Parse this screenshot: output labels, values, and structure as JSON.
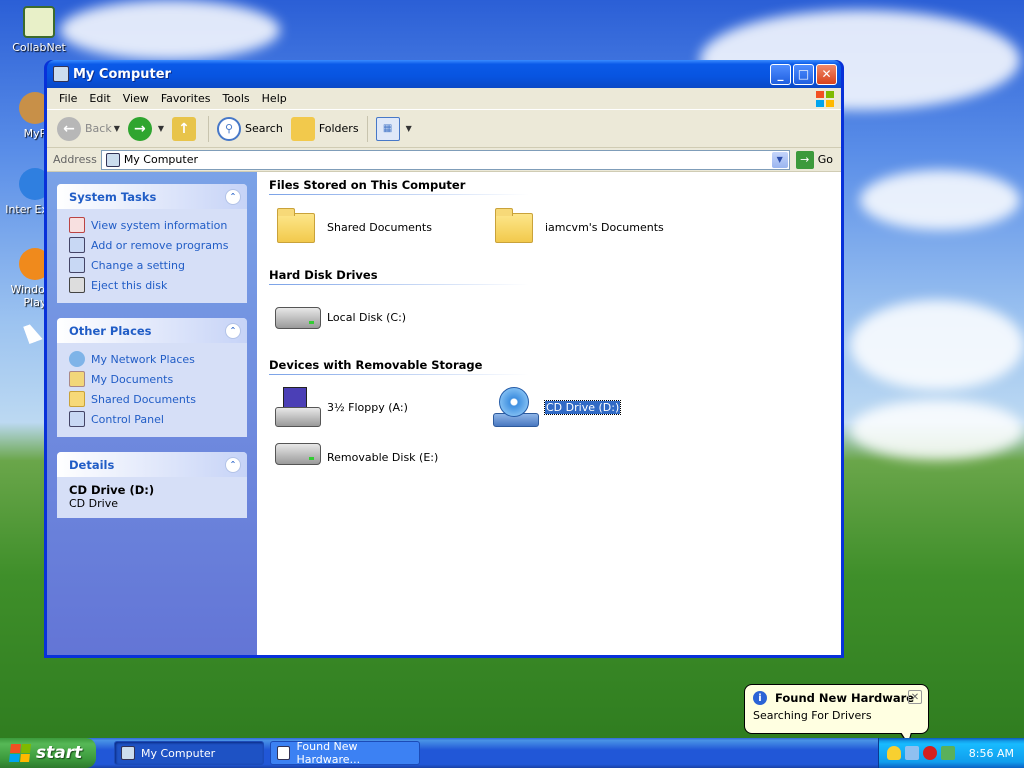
{
  "desktop": {
    "icons": [
      {
        "label": "CollabNet"
      },
      {
        "label": "MyP"
      },
      {
        "label": "Inter Explo"
      },
      {
        "label": "Windows Play"
      }
    ]
  },
  "window": {
    "title": "My Computer",
    "menu": [
      "File",
      "Edit",
      "View",
      "Favorites",
      "Tools",
      "Help"
    ],
    "toolbar": {
      "back": "Back",
      "search": "Search",
      "folders": "Folders"
    },
    "address": {
      "label": "Address",
      "value": "My Computer",
      "go": "Go"
    },
    "left_pane": {
      "system_tasks": {
        "title": "System Tasks",
        "items": [
          "View system information",
          "Add or remove programs",
          "Change a setting",
          "Eject this disk"
        ]
      },
      "other_places": {
        "title": "Other Places",
        "items": [
          "My Network Places",
          "My Documents",
          "Shared Documents",
          "Control Panel"
        ]
      },
      "details": {
        "title": "Details",
        "name": "CD Drive (D:)",
        "type": "CD Drive"
      }
    },
    "groups": {
      "files": {
        "title": "Files Stored on This Computer",
        "items": [
          "Shared Documents",
          "iamcvm's Documents"
        ]
      },
      "hard_disks": {
        "title": "Hard Disk Drives",
        "items": [
          "Local Disk (C:)"
        ]
      },
      "removable": {
        "title": "Devices with Removable Storage",
        "items": [
          "3½ Floppy (A:)",
          "CD Drive (D:)",
          "Removable Disk (E:)"
        ]
      }
    }
  },
  "taskbar": {
    "start": "start",
    "tasks": [
      "My Computer",
      "Found New Hardware..."
    ],
    "clock": "8:56 AM"
  },
  "balloon": {
    "title": "Found New Hardware",
    "message": "Searching For Drivers"
  },
  "colors": {
    "link_blue": "#215dc6",
    "selection": "#316ac5",
    "titlebar": "#0a5ae8"
  }
}
